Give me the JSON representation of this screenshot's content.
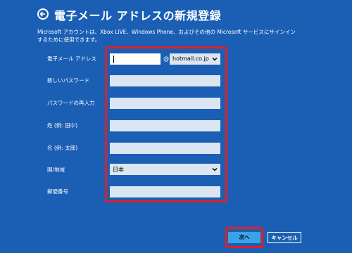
{
  "header": {
    "title": "電子メール アドレスの新規登録"
  },
  "description": {
    "line1": "Microsoft アカウントは、Xbox LIVE、Windows Phone、およびその他の Microsoft サービスにサインイン",
    "line2": "するために使用できます。"
  },
  "form": {
    "email_label": "電子メール アドレス",
    "email_value": "",
    "at_sign": "@",
    "domain_selected": "hotmail.co.jp",
    "new_password_label": "新しいパスワード",
    "confirm_password_label": "パスワードの再入力",
    "last_name_label": "姓 (例: 田中)",
    "first_name_label": "名 (例: 太郎)",
    "country_label": "国/地域",
    "country_selected": "日本",
    "postal_code_label": "郵便番号"
  },
  "buttons": {
    "next": "次へ",
    "cancel": "キャンセル"
  },
  "colors": {
    "background": "#1a5fb4",
    "highlight": "#e11f26",
    "field": "#dce6f2",
    "next_button": "#3aa3e8"
  }
}
